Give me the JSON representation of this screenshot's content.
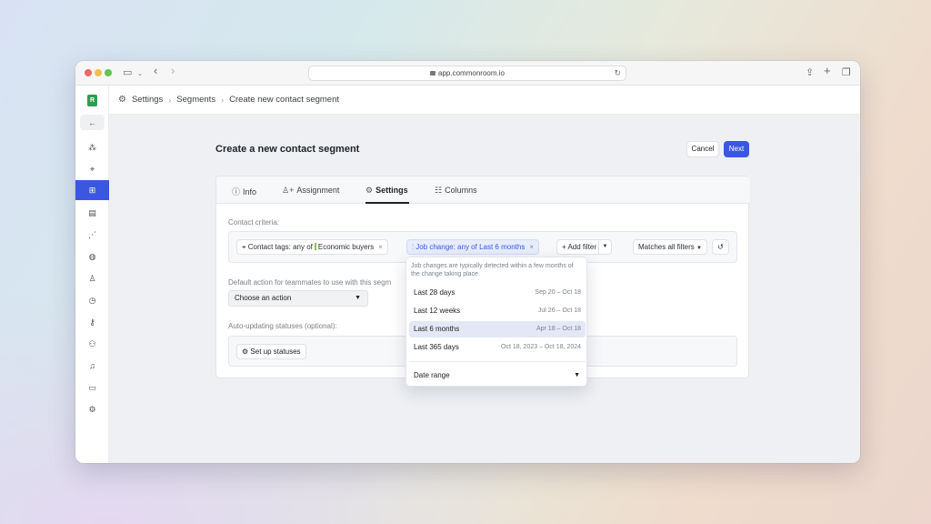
{
  "browser": {
    "url": "app.commonroom.io"
  },
  "breadcrumb": {
    "items": [
      "Settings",
      "Segments",
      "Create new contact segment"
    ]
  },
  "page": {
    "title": "Create a new contact segment",
    "cancel_label": "Cancel",
    "next_label": "Next"
  },
  "tabs": [
    {
      "label": "Info",
      "icon": "info-icon"
    },
    {
      "label": "Assignment",
      "icon": "user-plus-icon"
    },
    {
      "label": "Settings",
      "icon": "gear-icon",
      "active": true
    },
    {
      "label": "Columns",
      "icon": "columns-icon"
    }
  ],
  "criteria": {
    "label": "Contact criteria:",
    "tag_chip_prefix": "Contact tags: any of",
    "tag_chip_value": "Economic buyers",
    "job_chip_prefix": "Job change: any of",
    "job_chip_value": "Last 6 months",
    "add_filter_label": "+ Add filter",
    "matches_label": "Matches all filters"
  },
  "default_action": {
    "label": "Default action for teammates to use with this segm",
    "select_value": "Choose an action"
  },
  "statuses": {
    "label": "Auto-updating statuses (optional):",
    "button_label": "Set up statuses"
  },
  "dropdown": {
    "note": "Job changes are typically detected within a few months of the change taking place.",
    "options": [
      {
        "label": "Last 28 days",
        "range": "Sep 20 – Oct 18"
      },
      {
        "label": "Last 12 weeks",
        "range": "Jul 26 – Oct 18"
      },
      {
        "label": "Last 6 months",
        "range": "Apr 18 – Oct 18",
        "selected": true
      },
      {
        "label": "Last 365 days",
        "range": "Oct 18, 2023 – Oct 18, 2024"
      }
    ],
    "date_range_label": "Date range"
  },
  "colors": {
    "accent": "#3b57e0",
    "tag_bar": "#8bc34a",
    "logo": "#2e9e4f"
  }
}
